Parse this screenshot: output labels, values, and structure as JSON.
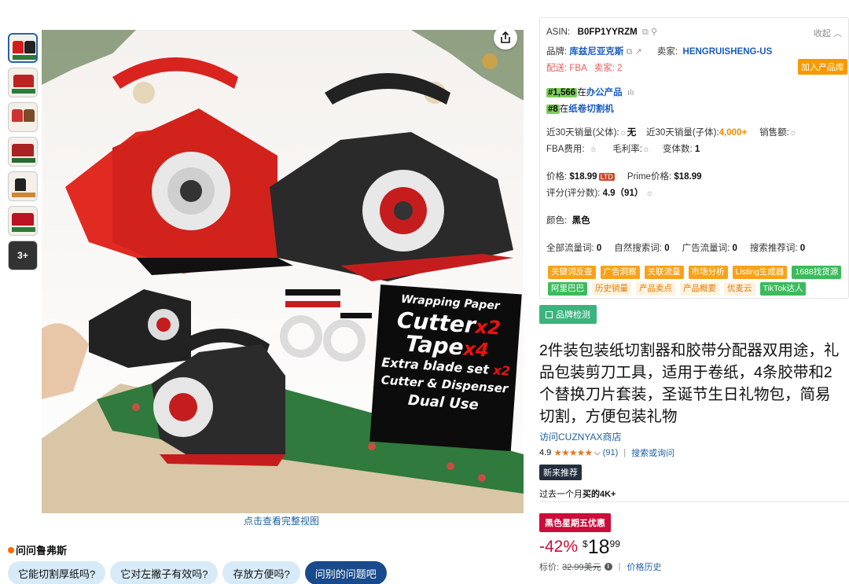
{
  "thumbnails": {
    "more_label": "3+"
  },
  "main_image": {
    "view_full_label": "点击查看完整视图",
    "overlay_lines": [
      "Wrapping Paper",
      "Cutter",
      "x2",
      "Tape",
      "x4",
      "Extra blade set",
      "x2",
      "Cutter & Dispenser",
      "Dual Use"
    ]
  },
  "ask": {
    "title": "问问鲁弗斯",
    "chips": [
      "它能切割厚纸吗?",
      "它对左撇子有效吗?",
      "存放方便吗?",
      "问别的问题吧"
    ]
  },
  "panel": {
    "asin_label": "ASIN:",
    "asin": "B0FP1YYRZM",
    "collapse": "收起",
    "brand_label": "品牌:",
    "brand": "库兹尼亚克斯",
    "seller_label": "卖家:",
    "seller": "HENGRUISHENG-US",
    "ship_label": "配送: FBA",
    "sellers_count": "卖家: 2",
    "add_lib": "加入产品库",
    "rank1_num": "#1,566",
    "rank1_in": "在",
    "rank1_cat": "办公产品",
    "rank2_num": "#8",
    "rank2_in": "在",
    "rank2_cat": "纸卷切割机",
    "sales_parent_label": "近30天销量(父体):",
    "sales_parent": "无",
    "sales_child_label": "近30天销量(子体):",
    "sales_child": "4,000+",
    "revenue_label": "销售额:",
    "fba_label": "FBA费用:",
    "margin_label": "毛利率:",
    "variants_label": "变体数:",
    "variants": "1",
    "price_label": "价格:",
    "price": "$18.99",
    "ltd": "LTD",
    "prime_label": "Prime价格:",
    "prime_price": "$18.99",
    "rating_label": "评分(评分数):",
    "rating_value": "4.9（91）",
    "color_label": "颜色:",
    "color": "黑色",
    "kw_all_label": "全部流量词:",
    "kw_all": "0",
    "kw_organic_label": "自然搜索词:",
    "kw_organic": "0",
    "kw_ads_label": "广告流量词:",
    "kw_ads": "0",
    "kw_rec_label": "搜索推荐词:",
    "kw_rec": "0",
    "tools": [
      {
        "label": "关键词反查",
        "style": "o"
      },
      {
        "label": "广告洞察",
        "style": "o"
      },
      {
        "label": "关联流量",
        "style": "o"
      },
      {
        "label": "市场分析",
        "style": "o"
      },
      {
        "label": "Listing生成器",
        "style": "o"
      },
      {
        "label": "1688找货源",
        "style": "g"
      },
      {
        "label": "阿里巴巴",
        "style": "g"
      },
      {
        "label": "历史销量",
        "style": "lo"
      },
      {
        "label": "产品卖点",
        "style": "lo"
      },
      {
        "label": "产品概要",
        "style": "lo"
      },
      {
        "label": "优麦云",
        "style": "lo"
      },
      {
        "label": "TikTok达人",
        "style": "g"
      }
    ]
  },
  "brand_check": "品牌检测",
  "product": {
    "title": "2件装包装纸切割器和胶带分配器双用途，礼品包装剪刀工具，适用于卷纸，4条胶带和2个替换刀片套装，圣诞节生日礼物包，简易切割，方便包装礼物",
    "store": "访问CUZNYAX商店",
    "rating": "4.9",
    "stars": "★★★★★",
    "rating_count": "(91)",
    "search_link": "搜索或询问",
    "new_badge": "新来推荐",
    "bought_prefix": "过去一个月",
    "bought_bold": "买的4K+",
    "deal_badge": "黑色星期五优惠",
    "discount": "-42%",
    "currency": "$",
    "price_whole": "18",
    "price_frac": "99",
    "list_label": "标价:",
    "list_price": "32.99美元",
    "price_history": "价格历史"
  }
}
